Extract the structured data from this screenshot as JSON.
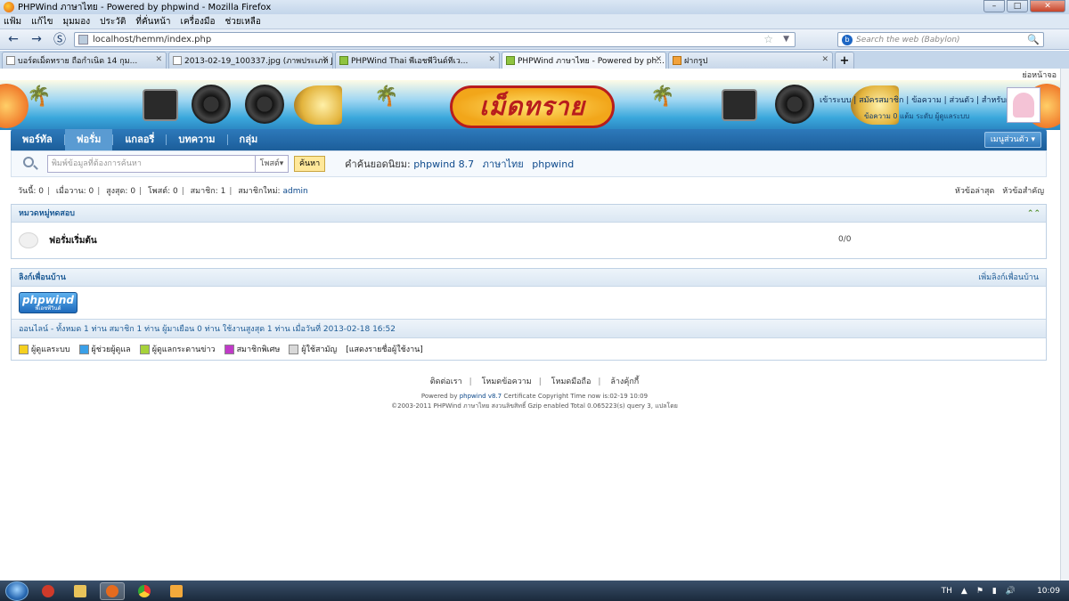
{
  "browser": {
    "title": "PHPWind ภาษาไทย - Powered by phpwind - Mozilla Firefox",
    "menu": [
      "แฟ้ม",
      "แก้ไข",
      "มุมมอง",
      "ประวัติ",
      "ที่คั่นหน้า",
      "เครื่องมือ",
      "ช่วยเหลือ"
    ],
    "url": "localhost/hemm/index.php",
    "search_placeholder": "Search the web (Babylon)",
    "tabs": [
      {
        "label": "บอร์ดเม็ดทราย ถือกำเนิด 14 กุม...",
        "active": false
      },
      {
        "label": "2013-02-19_100337.jpg (ภาพประเภท JP...",
        "active": false
      },
      {
        "label": "PHPWind Thai  พีเอชพีวินด์ทีเว...",
        "active": false
      },
      {
        "label": "PHPWind ภาษาไทย - Powered by ph...",
        "active": true
      },
      {
        "label": "ฝากรูป",
        "active": false
      }
    ],
    "new_tab": "+"
  },
  "page": {
    "top_link": "ย่อหน้าจอ",
    "logo_text": "เม็ดทราย",
    "user_links": "เข้าระบบ | สมัครสมาชิก | ข้อความ | ส่วนตัว | สำหรับผู้ดูแล",
    "user_sub": "ข้อความ 0 แต้ม  ระดับ ผู้ดูแลระบบ",
    "nav": {
      "items": [
        "พอร์ทัล",
        "ฟอรั่ม",
        "แกลอรี่",
        "บทความ",
        "กลุ่ม"
      ],
      "active_index": 1,
      "menu_button": "เมนูส่วนตัว"
    },
    "search": {
      "placeholder": "พิมพ์ข้อมูลที่ต้องการค้นหา",
      "select": "โพสต์",
      "button": "ค้นหา",
      "hot_label": "คำค้นยอดนิยม:",
      "hot_words": [
        "phpwind 8.7",
        "ภาษาไทย",
        "phpwind"
      ]
    },
    "stats": {
      "today_label": "วันนี้:",
      "today": "0",
      "yesterday_label": "เมื่อวาน:",
      "yesterday": "0",
      "max_label": "สูงสุด:",
      "max": "0",
      "posts_label": "โพสต์:",
      "posts": "0",
      "members_label": "สมาชิก:",
      "members": "1",
      "newest_label": "สมาชิกใหม่:",
      "newest": "admin"
    },
    "right_links": [
      "หัวข้อล่าสุด",
      "หัวข้อสำคัญ"
    ],
    "category": {
      "title": "หมวดหมู่ทดสอบ",
      "forum_name": "ฟอรั่มเริ่มต้น",
      "counts": "0/0"
    },
    "friends": {
      "title": "ลิงก์เพื่อนบ้าน",
      "add_link": "เพิ่มลิงก์เพื่อนบ้าน",
      "logo_text": "phpwind",
      "logo_sub": "พีเอชพีวินด์"
    },
    "online": "ออนไลน์ - ทั้งหมด 1 ท่าน สมาชิก 1 ท่าน ผู้มาเยือน 0 ท่าน ใช้งานสูงสุด 1 ท่าน เมื่อวันที่ 2013-02-18 16:52",
    "legend": [
      {
        "label": "ผู้ดูแลระบบ",
        "color": "#f5d020"
      },
      {
        "label": "ผู้ช่วยผู้ดูแล",
        "color": "#3aa0e8"
      },
      {
        "label": "ผู้ดูแลกระดานข่าว",
        "color": "#a6d23a"
      },
      {
        "label": "สมาชิกพิเศษ",
        "color": "#c03ac8"
      },
      {
        "label": "ผู้ใช้สามัญ",
        "color": "#d8d8d8"
      }
    ],
    "legend_link": "[แสดงรายชื่อผู้ใช้งาน]",
    "footer": {
      "links": [
        "ติดต่อเรา",
        "โหมดข้อความ",
        "โหมดมือถือ",
        "ล้างคุ้กกี้"
      ],
      "line1_prefix": "Powered by",
      "line1_brand": "phpwind v8.7",
      "line1_rest": "Certificate Copyright Time now is:02-19 10:09",
      "line2": "©2003-2011 PHPWind ภาษาไทย สงวนลิขสิทธิ์ Gzip enabled Total 0.065223(s) query 3, แปลโดย"
    }
  },
  "taskbar": {
    "lang": "TH",
    "clock": "10:09"
  }
}
